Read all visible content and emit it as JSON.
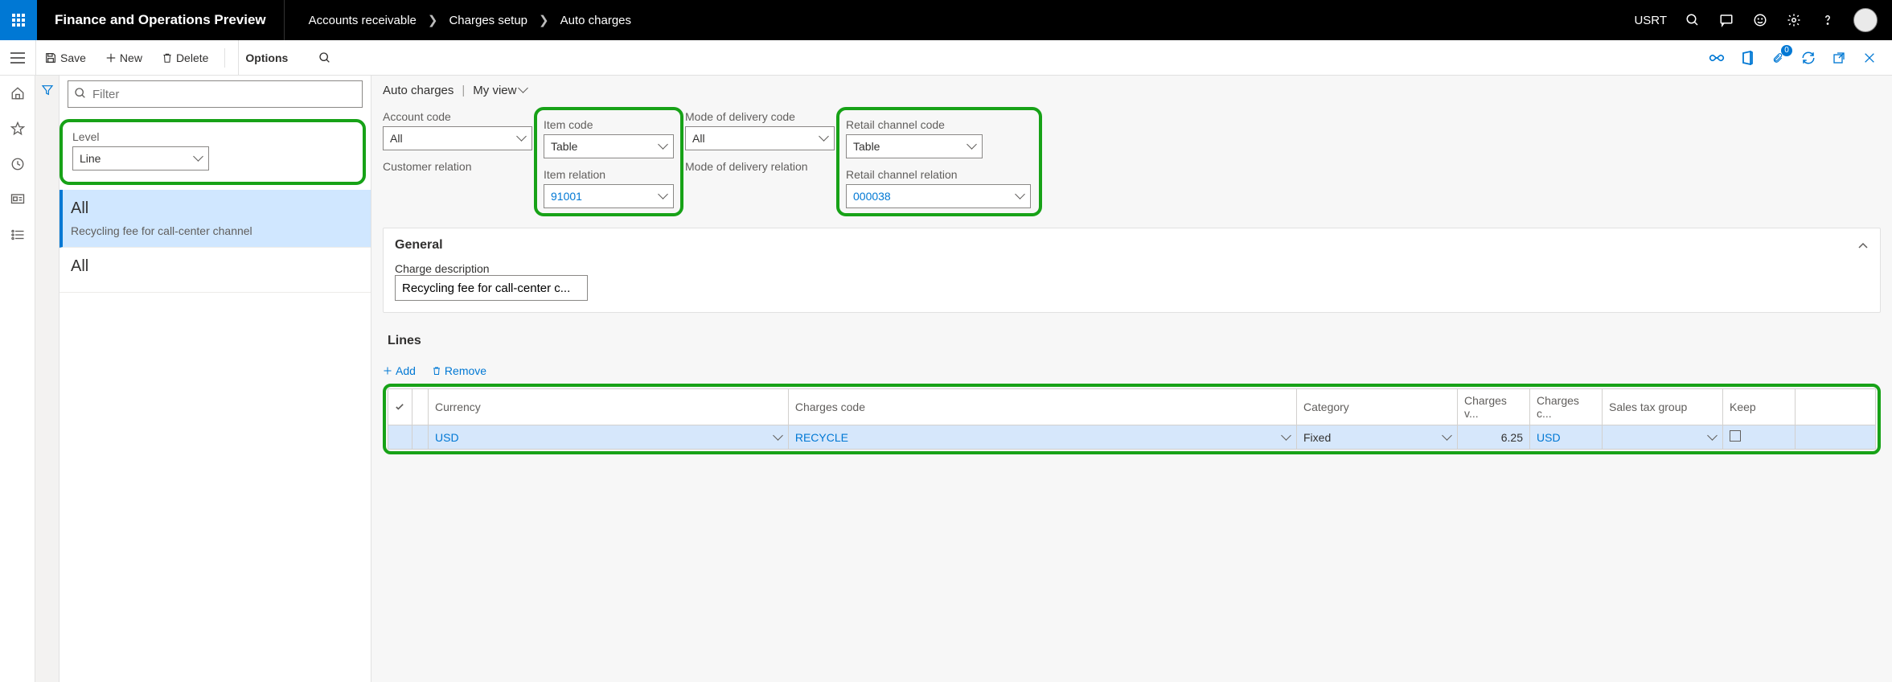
{
  "topbar": {
    "brand": "Finance and Operations Preview",
    "breadcrumbs": [
      "Accounts receivable",
      "Charges setup",
      "Auto charges"
    ],
    "user": "USRT"
  },
  "actionbar": {
    "save": "Save",
    "new": "New",
    "delete": "Delete",
    "options": "Options"
  },
  "filter": {
    "placeholder": "Filter"
  },
  "level": {
    "label": "Level",
    "value": "Line"
  },
  "list": [
    {
      "title": "All",
      "subtitle": "Recycling fee for call-center channel",
      "active": true
    },
    {
      "title": "All",
      "subtitle": "",
      "active": false
    }
  ],
  "mainhead": {
    "title": "Auto charges",
    "view": "My view"
  },
  "fields": {
    "account_code": {
      "label": "Account code",
      "value": "All"
    },
    "customer_relation": {
      "label": "Customer relation",
      "value": ""
    },
    "item_code": {
      "label": "Item code",
      "value": "Table"
    },
    "item_relation": {
      "label": "Item relation",
      "value": "91001"
    },
    "delivery_code": {
      "label": "Mode of delivery code",
      "value": "All"
    },
    "delivery_relation": {
      "label": "Mode of delivery relation",
      "value": ""
    },
    "channel_code": {
      "label": "Retail channel code",
      "value": "Table"
    },
    "channel_relation": {
      "label": "Retail channel relation",
      "value": "000038"
    }
  },
  "general": {
    "title": "General",
    "desc_label": "Charge description",
    "desc_value": "Recycling fee for call-center c..."
  },
  "lines": {
    "title": "Lines",
    "add": "Add",
    "remove": "Remove",
    "headers": {
      "currency": "Currency",
      "code": "Charges code",
      "category": "Category",
      "value": "Charges v...",
      "chargescur": "Charges c...",
      "tax": "Sales tax group",
      "keep": "Keep"
    },
    "rows": [
      {
        "currency": "USD",
        "code": "RECYCLE",
        "category": "Fixed",
        "value": "6.25",
        "chargescur": "USD",
        "tax": "",
        "keep": false
      }
    ]
  }
}
